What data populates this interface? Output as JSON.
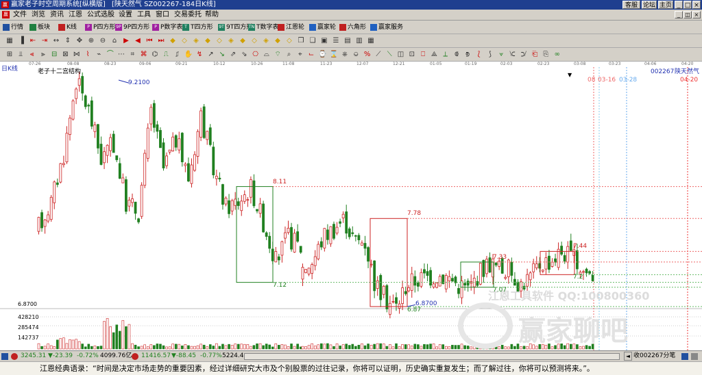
{
  "window": {
    "app_title": "赢家老子时空周期系统[纵横版]",
    "doc_title": "[陕天然气  SZ002267-184日K线]",
    "right_buttons": [
      "客服",
      "论坛",
      "主页"
    ]
  },
  "menu": [
    "文件",
    "浏览",
    "资讯",
    "江恩",
    "公式选股",
    "设置",
    "工具",
    "窗口",
    "交易委托",
    "帮助"
  ],
  "toolbar1": [
    {
      "label": "行情",
      "icon": "quote-board-icon",
      "color": "#2050a0"
    },
    {
      "label": "板块",
      "icon": "sector-icon",
      "color": "#208040"
    },
    {
      "label": "K线",
      "icon": "kline-icon",
      "color": "#c02020"
    },
    {
      "label": "P四方形",
      "icon": "p-square-icon",
      "color": "#a020a0",
      "mark": "P"
    },
    {
      "label": "9P四方形",
      "icon": "9p-square-icon",
      "color": "#a020a0",
      "mark": "9P"
    },
    {
      "label": "P数字表",
      "icon": "p-number-table-icon",
      "color": "#a020a0",
      "mark": "P"
    },
    {
      "label": "T四方形",
      "icon": "t-square-icon",
      "color": "#208060",
      "mark": "T"
    },
    {
      "label": "9T四方形",
      "icon": "9t-square-icon",
      "color": "#208060",
      "mark": "9T"
    },
    {
      "label": "T数字表",
      "icon": "t-number-table-icon",
      "color": "#208060",
      "mark": "TN"
    },
    {
      "label": "江恩轮",
      "icon": "gann-wheel-icon",
      "color": "#c02020"
    },
    {
      "label": "赢家轮",
      "icon": "winner-wheel-icon",
      "color": "#2060c0"
    },
    {
      "label": "六角形",
      "icon": "hexagon-icon",
      "color": "#c02020"
    },
    {
      "label": "赢家服务",
      "icon": "service-icon",
      "color": "#2060c0"
    }
  ],
  "period_label": "日K线",
  "indicator_name": "老子十二宫结构",
  "stock": {
    "code": "002267",
    "name": "陕天然气"
  },
  "dates": [
    "07-26",
    "08-08",
    "08-23",
    "09-06",
    "09-21",
    "10-12",
    "10-26",
    "11-08",
    "11-23",
    "12-07",
    "12-21",
    "01-05",
    "01-19",
    "02-03",
    "02-23",
    "03-08",
    "03-23",
    "04-06",
    "04-20"
  ],
  "vlines": [
    {
      "label": "03-16",
      "c": "#ee6666"
    },
    {
      "label": "03-28",
      "c": "#66aaee"
    },
    {
      "label": "04-20",
      "c": "#ee3333"
    }
  ],
  "extra_vline_labels": [
    "08"
  ],
  "price_marks": [
    {
      "t": "9.2100",
      "c": "#2030b0"
    },
    {
      "t": "8.11",
      "c": "#cc2222"
    },
    {
      "t": "7.12",
      "c": "#208020"
    },
    {
      "t": "7.78",
      "c": "#cc2222"
    },
    {
      "t": "6.8700",
      "c": "#2030b0"
    },
    {
      "t": "6.87",
      "c": "#208020"
    },
    {
      "t": "7.33",
      "c": "#cc2222"
    },
    {
      "t": "7.07",
      "c": "#208020"
    },
    {
      "t": "7.44",
      "c": "#cc2222"
    },
    {
      "t": "7.2",
      "c": "#208020"
    }
  ],
  "y_axis_labels": [
    "6.8700",
    "428210",
    "285474",
    "142737"
  ],
  "watermark": {
    "line1": "江恩工具软件  QQ:100800360",
    "line2": "赢家聊吧"
  },
  "status": {
    "index1": "3245.31",
    "chg1": "▼-23.39",
    "pct1": "-0.72%",
    "amt1": "4099.76亿",
    "index2": "11416.57",
    "chg2": "▼-88.45",
    "pct2": "-0.77%",
    "amt2": "5224.4",
    "right": "收002267分笔"
  },
  "quote": "江恩经典语录：“时间是决定市场走势的重要因素，经过详细研究大市及个别股票的过往记录，你将可以证明，历史确实重复发生；而了解过往，你将可以预测将来。”。",
  "colors": {
    "up": "#cc2222",
    "down": "#208020",
    "grid": "#ee6666",
    "title_bg": "#1f3f8f"
  },
  "chart_data": {
    "type": "candlestick",
    "categories": [
      "07-26",
      "08-08",
      "08-23",
      "09-06",
      "09-21",
      "10-12",
      "10-26",
      "11-08",
      "11-23",
      "12-07",
      "12-21",
      "01-05",
      "01-19",
      "02-03",
      "02-23",
      "03-08"
    ],
    "segments": [
      {
        "y0": 7.6,
        "trend": [
          7.7,
          7.95,
          8.45,
          9.21,
          8.9,
          8.4,
          8.55,
          7.95,
          7.85,
          8.9,
          8.3,
          8.6,
          8.2,
          8.85,
          8.3,
          7.9,
          7.96,
          8.1,
          7.75,
          7.34,
          7.6,
          7.48
        ]
      },
      {
        "y0": 7.16,
        "trend": [
          7.28,
          7.34,
          7.6,
          7.68,
          7.78,
          7.55,
          7.55,
          7.1,
          6.95,
          6.87,
          7.1,
          7.15,
          7.18,
          7.2,
          7.18,
          7.1,
          7.05,
          7.22,
          7.33,
          7.26,
          7.25,
          7.1,
          7.18,
          7.33,
          7.35,
          7.44,
          7.38,
          7.25,
          7.2
        ]
      }
    ],
    "boxes": [
      {
        "high": 8.11,
        "low": 7.12
      },
      {
        "high": 7.78,
        "low": 6.87
      },
      {
        "high": 7.33,
        "low": 7.07
      },
      {
        "high": 7.44,
        "low": 7.2
      }
    ],
    "high": 9.21,
    "low": 6.87,
    "volume_ticks": [
      428210,
      285474,
      142737
    ]
  }
}
